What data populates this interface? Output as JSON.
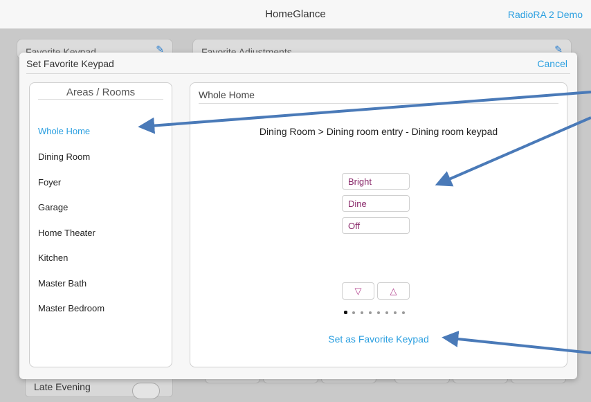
{
  "app": {
    "title": "HomeGlance",
    "demo_label": "RadioRA 2 Demo"
  },
  "background": {
    "favorite_keypad_label": "Favorite Keypad",
    "favorite_adjustments_label": "Favorite Adjustments",
    "late_evening_label": "Late Evening"
  },
  "modal": {
    "title": "Set Favorite Keypad",
    "cancel_label": "Cancel",
    "areas": {
      "header": "Areas / Rooms",
      "items": [
        {
          "label": "Whole Home",
          "selected": true
        },
        {
          "label": "Dining Room"
        },
        {
          "label": "Foyer"
        },
        {
          "label": "Garage"
        },
        {
          "label": "Home Theater"
        },
        {
          "label": "Kitchen"
        },
        {
          "label": "Master Bath"
        },
        {
          "label": "Master Bedroom"
        }
      ]
    },
    "keypad": {
      "header": "Whole Home",
      "path": "Dining Room > Dining room entry - Dining room keypad",
      "buttons": [
        "Bright",
        "Dine",
        "Off"
      ],
      "lower_label": "▽",
      "raise_label": "△",
      "page_count": 8,
      "current_page": 1,
      "set_favorite_label": "Set as Favorite Keypad"
    }
  },
  "colors": {
    "accent": "#2b9fe0",
    "keypad_button_text": "#8a2a6b",
    "annotation_arrow": "#4a7ab8"
  },
  "icons": [
    "pencil-icon",
    "triangle-down-icon",
    "triangle-up-icon",
    "toggle-icon"
  ]
}
